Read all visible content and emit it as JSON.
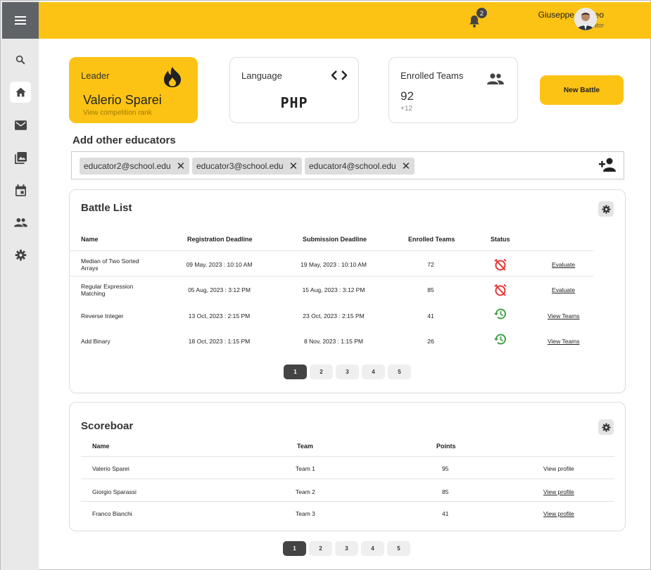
{
  "header": {
    "user_name": "Giuseppe Romeo",
    "user_role": "Educator",
    "notification_count": "2"
  },
  "sidebar": {
    "items": [
      {
        "icon": "menu-icon"
      },
      {
        "icon": "search-icon"
      },
      {
        "icon": "home-icon",
        "active": true
      },
      {
        "icon": "mail-icon"
      },
      {
        "icon": "photo-library-icon"
      },
      {
        "icon": "calendar-icon"
      },
      {
        "icon": "people-icon"
      },
      {
        "icon": "gear-icon"
      }
    ]
  },
  "cards": {
    "leader": {
      "title": "Leader",
      "name": "Valerio Sparei",
      "link": "View competition rank"
    },
    "language": {
      "title": "Language",
      "value": "PHP"
    },
    "teams": {
      "title": "Enrolled Teams",
      "value": "92",
      "delta": "+12"
    }
  },
  "new_battle_label": "New Battle",
  "educators": {
    "title": "Add other educators",
    "chips": [
      "educator2@school.edu",
      "educator3@school.edu",
      "educator4@school.edu"
    ]
  },
  "battle_list": {
    "title": "Battle List",
    "columns": [
      "Name",
      "Registration Deadline",
      "Submission Deadline",
      "Enrolled Teams",
      "Status"
    ],
    "rows": [
      {
        "name": [
          "Median of Two Sorted",
          "Arrays"
        ],
        "reg": "09 May, 2023 : 10:10 AM",
        "sub": "19 May, 2023 : 10:10 AM",
        "teams": "72",
        "status": "alarm-off-icon",
        "action": "Evaluate"
      },
      {
        "name": [
          "Regular Expression",
          "Matching"
        ],
        "reg": "05 Aug, 2023 : 3:12 PM",
        "sub": "15 Aug, 2023 : 3:12 PM",
        "teams": "85",
        "status": "alarm-off-icon",
        "action": "Evaluate"
      },
      {
        "name": [
          "Reverse Integer"
        ],
        "reg": "13 Oct, 2023 : 2:15 PM",
        "sub": "23 Oct, 2023 : 2:15 PM",
        "teams": "41",
        "status": "history-icon",
        "action": "View Teams"
      },
      {
        "name": [
          "Add Binary"
        ],
        "reg": "18 Oct, 2023 : 1:15 PM",
        "sub": "8 Nov, 2023 : 1:15 PM",
        "teams": "26",
        "status": "history-icon",
        "action": "View Teams"
      }
    ],
    "pages": [
      "1",
      "2",
      "3",
      "4",
      "5"
    ]
  },
  "scoreboard": {
    "title": "Scoreboar",
    "columns": [
      "Name",
      "Team",
      "Points"
    ],
    "rows": [
      {
        "name": "Valerio Sparei",
        "team": "Team 1",
        "points": "95",
        "action": "View profile"
      },
      {
        "name": "Giorgio Sparassi",
        "team": "Team 2",
        "points": "85",
        "action": "View profile"
      },
      {
        "name": "Franco Bianchi",
        "team": "Team 3",
        "points": "41",
        "action": "View profile"
      }
    ],
    "pages": [
      "1",
      "2",
      "3",
      "4",
      "5"
    ]
  },
  "colors": {
    "accent": "#fcc315",
    "alert": "#e53935",
    "ok": "#43a047"
  }
}
